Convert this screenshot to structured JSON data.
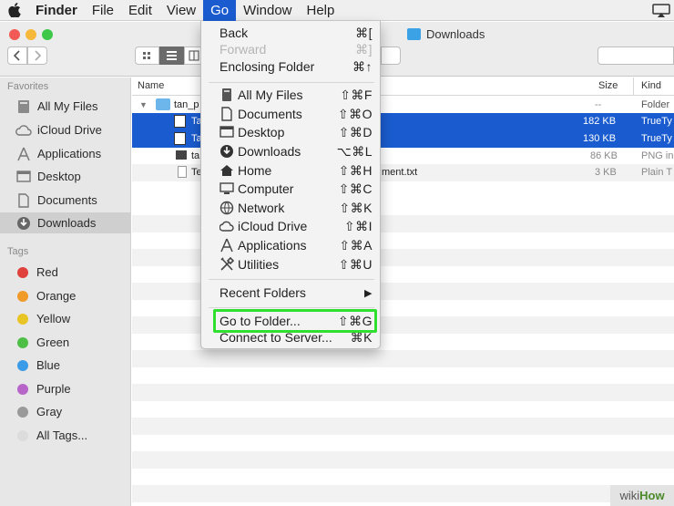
{
  "menubar": {
    "app_name": "Finder",
    "items": [
      "File",
      "Edit",
      "View",
      "Go",
      "Window",
      "Help"
    ]
  },
  "window": {
    "title": "Downloads"
  },
  "sidebar": {
    "favorites_header": "Favorites",
    "favorites": [
      {
        "label": "All My Files",
        "icon": "all-files-icon"
      },
      {
        "label": "iCloud Drive",
        "icon": "cloud-icon"
      },
      {
        "label": "Applications",
        "icon": "applications-icon"
      },
      {
        "label": "Desktop",
        "icon": "desktop-icon"
      },
      {
        "label": "Documents",
        "icon": "documents-icon"
      },
      {
        "label": "Downloads",
        "icon": "downloads-icon",
        "selected": true
      }
    ],
    "tags_header": "Tags",
    "tags": [
      {
        "label": "Red",
        "color": "#e0413d"
      },
      {
        "label": "Orange",
        "color": "#ef9a29"
      },
      {
        "label": "Yellow",
        "color": "#e8c524"
      },
      {
        "label": "Green",
        "color": "#4cbf44"
      },
      {
        "label": "Blue",
        "color": "#3c9be6"
      },
      {
        "label": "Purple",
        "color": "#b765c9"
      },
      {
        "label": "Gray",
        "color": "#9a9a9a"
      },
      {
        "label": "All Tags...",
        "color": "#dcdcdc"
      }
    ]
  },
  "filelist": {
    "columns": {
      "name": "Name",
      "size": "Size",
      "kind": "Kind"
    },
    "rows": [
      {
        "name": "tan_p",
        "size": "--",
        "kind": "Folder",
        "selected": false
      },
      {
        "name": "Ta",
        "size": "182 KB",
        "kind": "TrueTy",
        "selected": true
      },
      {
        "name": "Ta",
        "size": "130 KB",
        "kind": "TrueTy",
        "selected": true
      },
      {
        "name": "ta",
        "size": "86 KB",
        "kind": "PNG in",
        "selected": false
      },
      {
        "name": "Te",
        "name_tail": "ment.txt",
        "size": "3 KB",
        "kind": "Plain T",
        "selected": false
      }
    ]
  },
  "go_menu": {
    "items": [
      {
        "label": "Back",
        "shortcut": "⌘[",
        "disabled": false
      },
      {
        "label": "Forward",
        "shortcut": "⌘]",
        "disabled": true
      },
      {
        "label": "Enclosing Folder",
        "shortcut": "⌘↑",
        "disabled": false
      },
      {
        "label": "All My Files",
        "shortcut": "⇧⌘F",
        "icon": "all-files-icon"
      },
      {
        "label": "Documents",
        "shortcut": "⇧⌘O",
        "icon": "documents-icon"
      },
      {
        "label": "Desktop",
        "shortcut": "⇧⌘D",
        "icon": "desktop-icon"
      },
      {
        "label": "Downloads",
        "shortcut": "⌥⌘L",
        "icon": "downloads-icon"
      },
      {
        "label": "Home",
        "shortcut": "⇧⌘H",
        "icon": "home-icon"
      },
      {
        "label": "Computer",
        "shortcut": "⇧⌘C",
        "icon": "computer-icon"
      },
      {
        "label": "Network",
        "shortcut": "⇧⌘K",
        "icon": "network-icon"
      },
      {
        "label": "iCloud Drive",
        "shortcut": "⇧⌘I",
        "icon": "cloud-icon"
      },
      {
        "label": "Applications",
        "shortcut": "⇧⌘A",
        "icon": "applications-icon"
      },
      {
        "label": "Utilities",
        "shortcut": "⇧⌘U",
        "icon": "utilities-icon"
      },
      {
        "label": "Recent Folders",
        "shortcut": "▶",
        "submenu": true
      },
      {
        "label": "Go to Folder...",
        "shortcut": "⇧⌘G",
        "highlighted": true
      },
      {
        "label": "Connect to Server...",
        "shortcut": "⌘K"
      }
    ]
  },
  "watermark": {
    "prefix": "wiki",
    "suffix": "How"
  },
  "colors": {
    "accent": "#1a5ccf",
    "highlight_box": "#2fe02f"
  }
}
